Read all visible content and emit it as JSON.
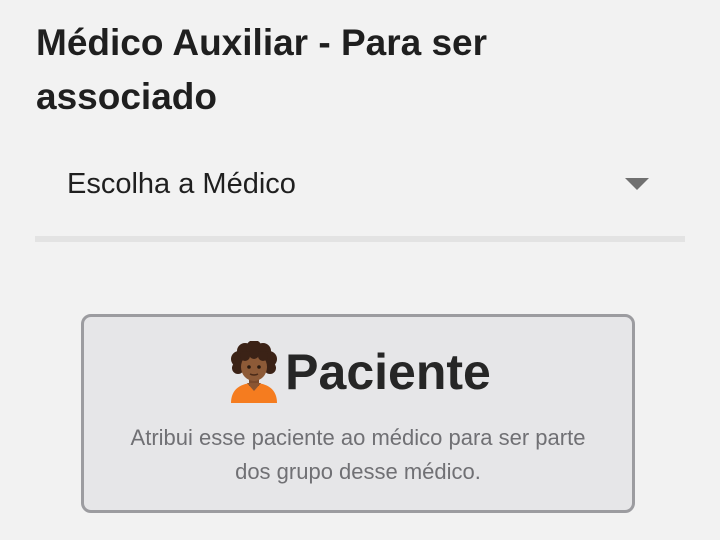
{
  "header": {
    "title": "Médico Auxiliar - Para ser associado"
  },
  "doctor_select": {
    "selected_value": "Escolha a Médico",
    "icon": "chevron-down-icon"
  },
  "patient_card": {
    "icon": "person-curly-hair-icon",
    "title": "Paciente",
    "description": "Atribui esse paciente ao médico para ser parte dos grupo desse médico."
  },
  "colors": {
    "background": "#f2f2f2",
    "card_background": "#e6e6e8",
    "card_border": "#9c9ca0",
    "text_primary": "#1f1f1f",
    "text_secondary": "#707074"
  }
}
